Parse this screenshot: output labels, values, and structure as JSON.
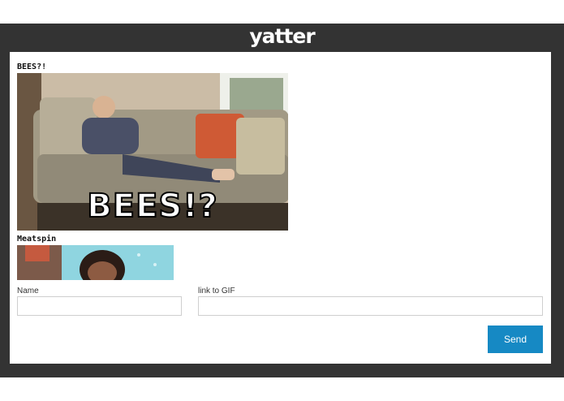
{
  "header": {
    "logo_text": "yatter"
  },
  "messages": [
    {
      "title": "BEES?!",
      "gif_caption": "BEES!?"
    },
    {
      "title": "Meatspin"
    }
  ],
  "form": {
    "name_label": "Name",
    "name_value": "",
    "gif_label": "link to GIF",
    "gif_value": "",
    "send_label": "Send"
  },
  "colors": {
    "frame": "#333333",
    "panel": "#ffffff",
    "send_button": "#1689c4"
  }
}
